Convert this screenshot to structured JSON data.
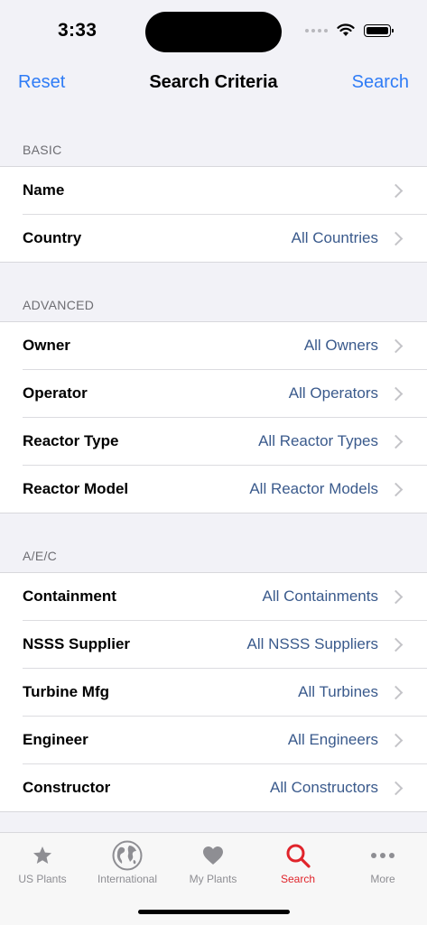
{
  "status": {
    "time": "3:33"
  },
  "nav": {
    "left_button": "Reset",
    "title": "Search Criteria",
    "right_button": "Search"
  },
  "sections": [
    {
      "header": "BASIC",
      "rows": [
        {
          "label": "Name",
          "value": ""
        },
        {
          "label": "Country",
          "value": "All Countries"
        }
      ]
    },
    {
      "header": "ADVANCED",
      "rows": [
        {
          "label": "Owner",
          "value": "All Owners"
        },
        {
          "label": "Operator",
          "value": "All Operators"
        },
        {
          "label": "Reactor Type",
          "value": "All Reactor Types"
        },
        {
          "label": "Reactor Model",
          "value": "All Reactor Models"
        }
      ]
    },
    {
      "header": "A/E/C",
      "rows": [
        {
          "label": "Containment",
          "value": "All Containments"
        },
        {
          "label": "NSSS Supplier",
          "value": "All NSSS Suppliers"
        },
        {
          "label": "Turbine Mfg",
          "value": "All Turbines"
        },
        {
          "label": "Engineer",
          "value": "All Engineers"
        },
        {
          "label": "Constructor",
          "value": "All Constructors"
        }
      ]
    }
  ],
  "tabs": [
    {
      "label": "US Plants",
      "icon": "star-icon"
    },
    {
      "label": "International",
      "icon": "globe-icon"
    },
    {
      "label": "My Plants",
      "icon": "heart-icon"
    },
    {
      "label": "Search",
      "icon": "search-icon",
      "active": true
    },
    {
      "label": "More",
      "icon": "more-icon"
    }
  ],
  "colors": {
    "accent": "#2f7cf6",
    "active_tab": "#e0242b",
    "value_text": "#3a5a8c",
    "background": "#f2f2f7"
  }
}
